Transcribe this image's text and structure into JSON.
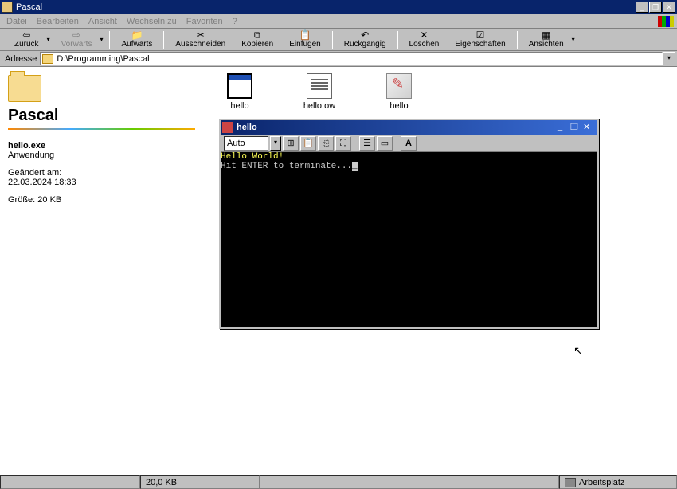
{
  "window": {
    "title": "Pascal"
  },
  "menu": {
    "items": [
      "Datei",
      "Bearbeiten",
      "Ansicht",
      "Wechseln zu",
      "Favoriten",
      "?"
    ]
  },
  "toolbar": {
    "back": "Zurück",
    "forward": "Vorwärts",
    "up": "Aufwärts",
    "cut": "Ausschneiden",
    "copy": "Kopieren",
    "paste": "Einfügen",
    "undo": "Rückgängig",
    "delete": "Löschen",
    "properties": "Eigenschaften",
    "views": "Ansichten"
  },
  "address": {
    "label": "Adresse",
    "path": "D:\\Programming\\Pascal"
  },
  "sidebar": {
    "folder_name": "Pascal",
    "selected": {
      "name": "hello.exe",
      "type": "Anwendung",
      "modified_label": "Geändert am:",
      "modified_value": "22.03.2024 18:33",
      "size_label": "Größe:",
      "size_value": "20 KB"
    }
  },
  "files": [
    {
      "name": "hello",
      "icon": "window"
    },
    {
      "name": "hello.ow",
      "icon": "doc"
    },
    {
      "name": "hello",
      "icon": "exe"
    }
  ],
  "console": {
    "title": "hello",
    "font_mode": "Auto",
    "output_line1": "Hello World!",
    "output_line2": "Hit ENTER to terminate..."
  },
  "statusbar": {
    "size": "20,0 KB",
    "location": "Arbeitsplatz"
  }
}
